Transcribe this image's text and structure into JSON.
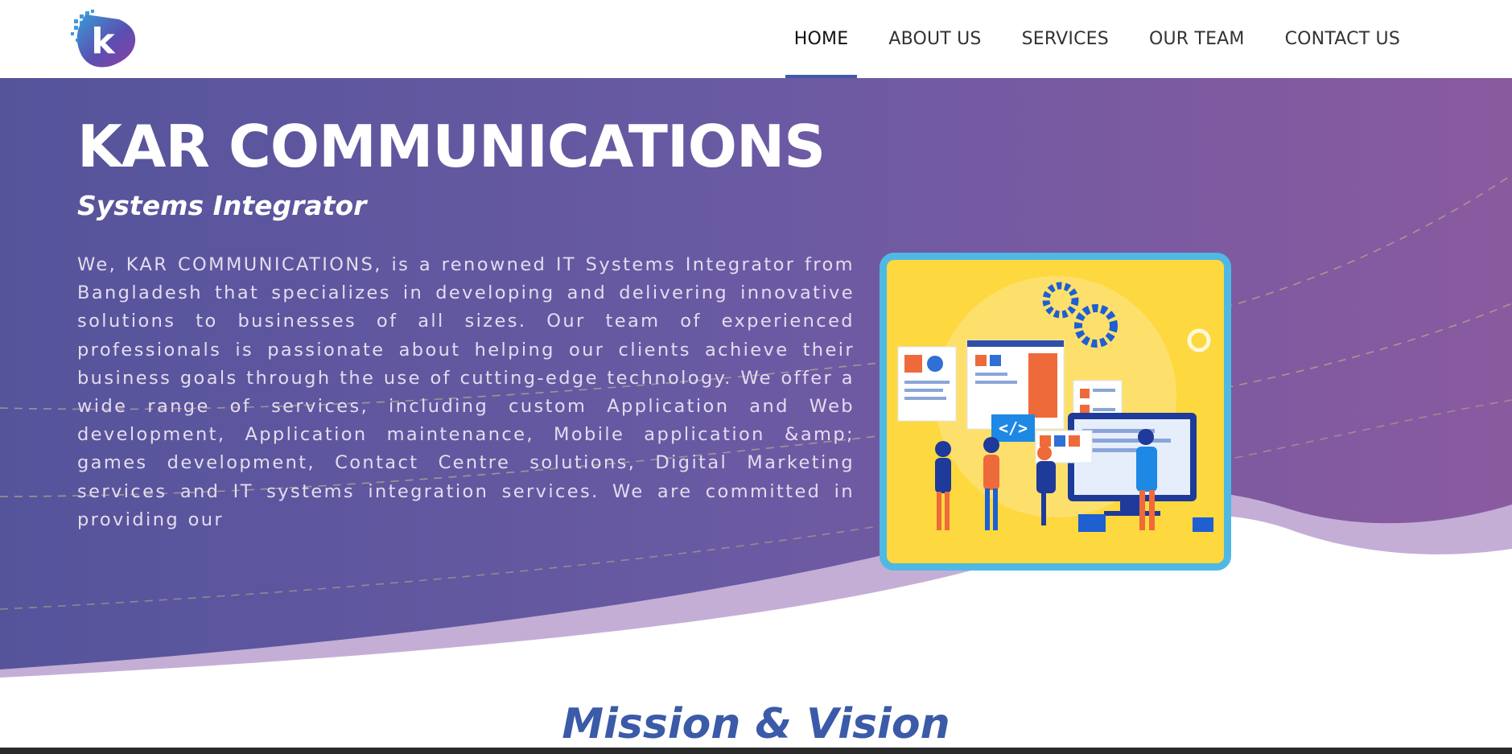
{
  "brand": {
    "logo_letter": "k"
  },
  "nav": {
    "items": [
      {
        "label": "HOME",
        "active": true
      },
      {
        "label": "ABOUT US",
        "active": false
      },
      {
        "label": "SERVICES",
        "active": false
      },
      {
        "label": "OUR TEAM",
        "active": false
      },
      {
        "label": "CONTACT US",
        "active": false
      }
    ]
  },
  "hero": {
    "title": "KAR COMMUNICATIONS",
    "subtitle": "Systems Integrator",
    "intro": "We, KAR COMMUNICATIONS, is a renowned IT Systems Integrator from Bangladesh that specializes in developing and delivering innovative solutions to businesses of all sizes. Our team of experienced professionals is passionate about helping our clients achieve their business goals through the use of cutting-edge technology. We offer a wide range of services, including custom Application and Web development, Application maintenance, Mobile application &amp; games development, Contact Centre solutions, Digital Marketing services and IT systems integration services. We are committed in providing our",
    "illustration_icon": "developer-team-illustration",
    "code_tag": "</>"
  },
  "section": {
    "mission_title": "Mission & Vision"
  },
  "colors": {
    "gradient_left": "#55549b",
    "gradient_mid": "#6a5aa3",
    "gradient_right": "#8a5a9f",
    "wave_light": "#c4aed6",
    "accent_blue": "#3b5aa8",
    "illustration_bg": "#fdd83f",
    "illustration_border": "#4fb9e3"
  }
}
